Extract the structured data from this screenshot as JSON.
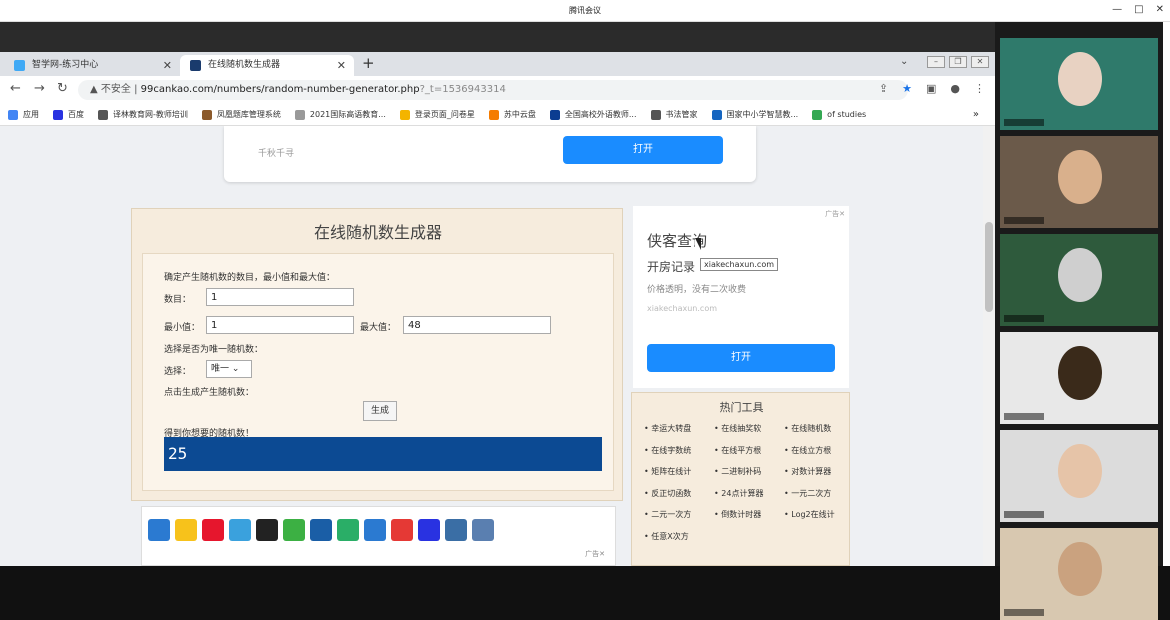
{
  "window": {
    "title": "腾讯会议",
    "controls": [
      "—",
      "□",
      "✕"
    ]
  },
  "tabs": [
    {
      "label": "智学网-练习中心",
      "color": "#3fa9f5"
    },
    {
      "label": "在线随机数生成器",
      "color": "#1a3b6d"
    }
  ],
  "address": {
    "insecure_label": "不安全",
    "url": "99cankao.com/numbers/random-number-generator.php",
    "query": "?_t=1536943314"
  },
  "bookmarks": [
    {
      "label": "应用",
      "color": "#4285f4"
    },
    {
      "label": "百度",
      "color": "#2932e1"
    },
    {
      "label": "译林教育网-教师培训",
      "color": "#555555"
    },
    {
      "label": "凤凰题库管理系统",
      "color": "#8b5a2b"
    },
    {
      "label": "2021国际高语教育...",
      "color": "#999999"
    },
    {
      "label": "登录页面_问卷星",
      "color": "#f4b400"
    },
    {
      "label": "苏中云盘",
      "color": "#f57c00"
    },
    {
      "label": "全国高校外语教师...",
      "color": "#0b3d91"
    },
    {
      "label": "书法管家",
      "color": "#555555"
    },
    {
      "label": "国家中小学智慧教...",
      "color": "#1565c0"
    },
    {
      "label": "of studies",
      "color": "#34a853"
    }
  ],
  "top_card": {
    "text": "千秋千寻",
    "button": "打开"
  },
  "generator": {
    "title": "在线随机数生成器",
    "instruction": "确定产生随机数的数目，最小值和最大值：",
    "count_label": "数目：",
    "count_value": "1",
    "min_label": "最小值：",
    "min_value": "1",
    "max_label": "最大值：",
    "max_value": "48",
    "unique_prompt": "选择是否为唯一随机数：",
    "select_label": "选择：",
    "select_value": "唯一",
    "click_prompt": "点击生成产生随机数：",
    "generate_button": "生成",
    "result_label": "得到你想要的随机数！",
    "result_value": "25"
  },
  "ad": {
    "mark": "广告✕",
    "title": "侠客查询",
    "subtitle": "开房记录",
    "tooltip": "xiakechaxun.com",
    "description": "价格透明，没有二次收费",
    "url": "xiakechaxun.com",
    "button": "打开"
  },
  "hot_tools": {
    "title": "热门工具",
    "items": [
      "幸运大转盘",
      "在线抽奖软",
      "在线随机数",
      "在线字数统",
      "在线平方根",
      "在线立方根",
      "矩阵在线计",
      "二进制补码",
      "对数计算器",
      "反正切函数",
      "24点计算器",
      "一元二次方",
      "二元一次方",
      "倒数计时器",
      "Log2在线计",
      "任意X次方"
    ]
  },
  "share": {
    "ad_mark": "广告✕",
    "icons": [
      {
        "name": "plus-share-icon",
        "color": "#2b7ad1"
      },
      {
        "name": "qzone-icon",
        "color": "#f7c21b"
      },
      {
        "name": "weibo-icon",
        "color": "#e6162d"
      },
      {
        "name": "tencent-weibo-icon",
        "color": "#3aa1dd"
      },
      {
        "name": "qq-icon",
        "color": "#222222"
      },
      {
        "name": "clover-icon",
        "color": "#3cb043"
      },
      {
        "name": "renren-icon",
        "color": "#1a5ea6"
      },
      {
        "name": "wechat-icon",
        "color": "#2aae67"
      },
      {
        "name": "anchor-icon",
        "color": "#2b7ad1"
      },
      {
        "name": "star-icon",
        "color": "#e53935"
      },
      {
        "name": "baidu-icon",
        "color": "#2932e1"
      },
      {
        "name": "bookmark-icon",
        "color": "#3a6ea5"
      },
      {
        "name": "print-icon",
        "color": "#5a7fb0"
      }
    ]
  },
  "participants": [
    {
      "bg": "#2f7a6b",
      "face": "#e8d2c2"
    },
    {
      "bg": "#6b5a4a",
      "face": "#d9b08c"
    },
    {
      "bg": "#2e5a3c",
      "face": "#cfcfcf"
    },
    {
      "bg": "#e8e8e8",
      "face": "#3a2a1a"
    },
    {
      "bg": "#dcdcdc",
      "face": "#e6c4a8"
    },
    {
      "bg": "#d8c8b0",
      "face": "#caa27f"
    }
  ]
}
